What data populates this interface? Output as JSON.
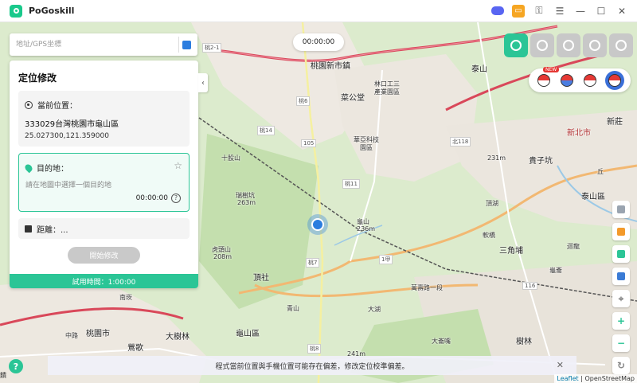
{
  "app": {
    "title": "PoGoskill"
  },
  "search": {
    "placeholder": "地址/GPS坐標"
  },
  "timer": {
    "value": "00:00:00"
  },
  "panel": {
    "title": "定位修改",
    "current": {
      "label": "當前位置：",
      "address": "333029台灣桃園市龜山區",
      "coords": "25.027300,121.359000"
    },
    "destination": {
      "label": "目的地：",
      "placeholder": "請在地圖中選擇一個目的地",
      "time": "00:00:00",
      "help": "?"
    },
    "distance": {
      "label": "距離：..."
    },
    "start_button": "開始修改",
    "trial": "試用時間：1:00:00"
  },
  "poke_toolbar": {
    "new_badge": "NEW"
  },
  "notice": {
    "text": "程式當前位置與手機位置可能存在偏差，修改定位校準偏差。"
  },
  "attribution": {
    "leaflet": "Leaflet",
    "osm": "| OpenStreetMap"
  },
  "feedback": "饋",
  "help_fab": "?",
  "map_labels": [
    "桃園新市鎮",
    "林口工三",
    "產業園區",
    "菜公堂",
    "桃6",
    "桃14",
    "105",
    "華亞科技",
    "園區",
    "北118",
    "桃11",
    "龜山",
    "236m",
    "泰山",
    "貴子坑",
    "231m",
    "丘",
    "軟橋",
    "瑞樹坑",
    "263m",
    "虎頭山",
    "208m",
    "十股山",
    "桃7",
    "1甲",
    "頂社",
    "三角埔",
    "南崁",
    "龜山區",
    "桃園市",
    "中路",
    "大樹林",
    "青山",
    "大湖",
    "桃8",
    "大崙嘴",
    "樹林",
    "龜崙",
    "萬壽路一段",
    "116",
    "新莊",
    "迴龍",
    "鶯歌",
    "241m",
    "頂湖",
    "泰山區",
    "新北市",
    "桃2-1"
  ]
}
